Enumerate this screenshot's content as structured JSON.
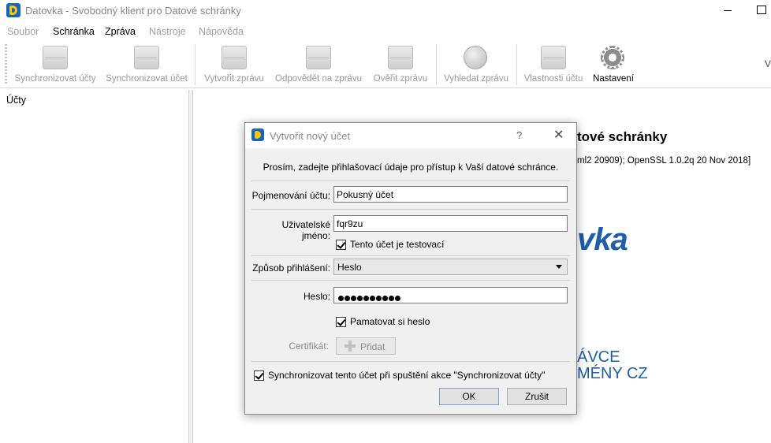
{
  "window": {
    "title": "Datovka - Svobodný klient pro Datové schránky"
  },
  "menu": {
    "items": [
      {
        "label": "Soubor",
        "enabled": false
      },
      {
        "label": "Schránka",
        "enabled": true
      },
      {
        "label": "Zpráva",
        "enabled": true
      },
      {
        "label": "Nástroje",
        "enabled": false
      },
      {
        "label": "Nápověda",
        "enabled": false
      }
    ]
  },
  "toolbar": {
    "buttons": [
      {
        "label": "Synchronizovat účty",
        "icon": "sync-all-icon",
        "enabled": false
      },
      {
        "label": "Synchronizovat účet",
        "icon": "sync-icon",
        "enabled": false
      },
      {
        "label": "Vytvořit zprávu",
        "icon": "new-message-icon",
        "enabled": false
      },
      {
        "label": "Odpovědět na zprávu",
        "icon": "reply-icon",
        "enabled": false
      },
      {
        "label": "Ověřit zprávu",
        "icon": "verify-icon",
        "enabled": false
      },
      {
        "label": "Vyhledat zprávu",
        "icon": "search-icon",
        "enabled": false
      },
      {
        "label": "Vlastnosti účtu",
        "icon": "account-properties-icon",
        "enabled": false
      },
      {
        "label": "Nastavení",
        "icon": "gear-icon",
        "enabled": true
      }
    ],
    "overflow_label": "V"
  },
  "left_pane": {
    "title": "Účty"
  },
  "background_content": {
    "heading": "tové schránky",
    "info": "ml2 20909); OpenSSL 1.0.2q 20 Nov 2018]",
    "logo": "vka",
    "cz_line1": "ÁVCE",
    "cz_line2": "MÉNY CZ"
  },
  "dialog": {
    "title": "Vytvořit nový účet",
    "help": "?",
    "intro": "Prosím, zadejte přihlašovací údaje pro přístup k Vaší datové schránce.",
    "account_name_label": "Pojmenování účtu:",
    "account_name_value": "Pokusný účet",
    "username_label": "Uživatelské jméno:",
    "username_value": "fqr9zu",
    "test_account_label": "Tento účet je testovací",
    "test_account_checked": true,
    "login_method_label": "Způsob přihlášení:",
    "login_method_value": "Heslo",
    "password_label": "Heslo:",
    "password_length": 10,
    "remember_password_label": "Pamatovat si heslo",
    "remember_password_checked": true,
    "certificate_label": "Certifikát:",
    "certificate_button": "Přidat",
    "sync_on_start_label": "Synchronizovat tento účet při spuštění akce \"Synchronizovat účty\"",
    "sync_on_start_checked": true,
    "ok_button": "OK",
    "cancel_button": "Zrušit"
  }
}
